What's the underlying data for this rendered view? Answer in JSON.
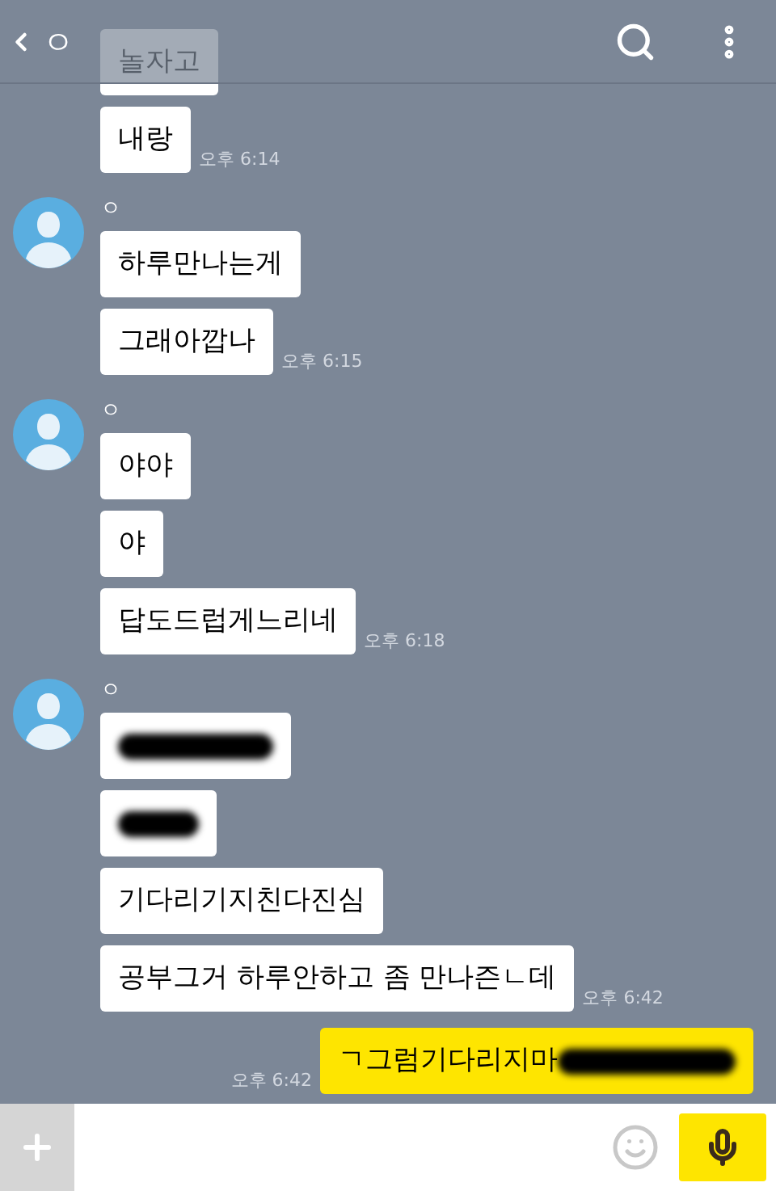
{
  "header": {
    "title": "ㅇ"
  },
  "groups": [
    {
      "outgoing": false,
      "messages": [
        {
          "kind": "text",
          "text": "놀자고"
        },
        {
          "kind": "text",
          "text": "내랑"
        }
      ],
      "time": "오후 6:14"
    },
    {
      "outgoing": false,
      "sender": "ㅇ",
      "messages": [
        {
          "kind": "text",
          "text": "하루만나는게"
        },
        {
          "kind": "text",
          "text": "그래아깝나"
        }
      ],
      "time": "오후 6:15"
    },
    {
      "outgoing": false,
      "sender": "ㅇ",
      "messages": [
        {
          "kind": "text",
          "text": "야야"
        },
        {
          "kind": "text",
          "text": "야"
        },
        {
          "kind": "text",
          "text": "답도드럽게느리네"
        }
      ],
      "time": "오후 6:18"
    },
    {
      "outgoing": false,
      "sender": "ㅇ",
      "messages": [
        {
          "kind": "scribble"
        },
        {
          "kind": "shortscribble"
        },
        {
          "kind": "text",
          "text": "기다리기지친다진심"
        },
        {
          "kind": "text",
          "text": "공부그거 하루안하고 좀 만나즌ㄴ데"
        }
      ],
      "time": "오후 6:42"
    },
    {
      "outgoing": true,
      "messages": [
        {
          "kind": "scribbled",
          "text": "ㄱ그럼기다리지마"
        }
      ],
      "time": "오후 6:42"
    }
  ]
}
